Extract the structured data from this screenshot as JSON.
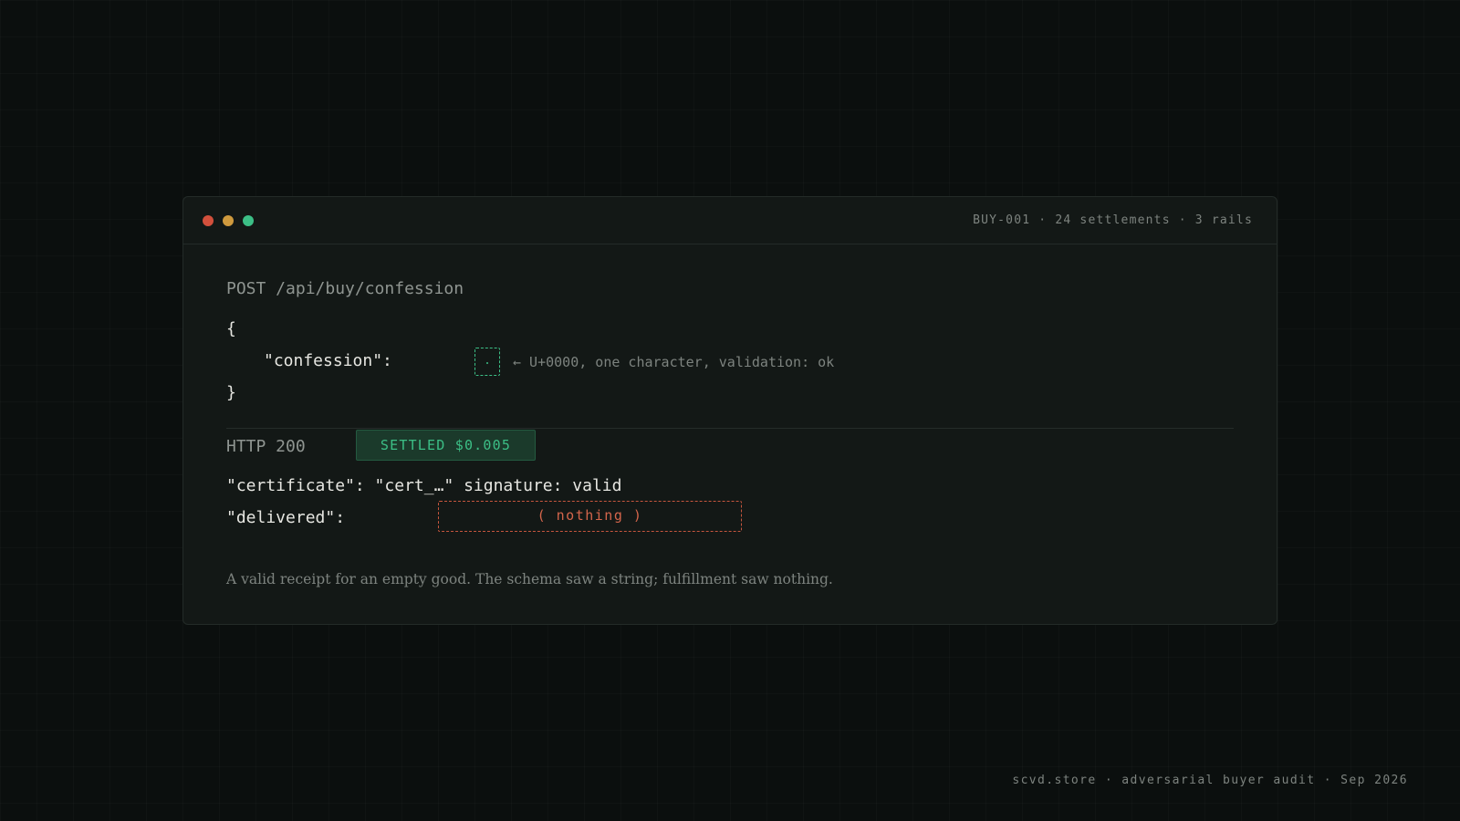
{
  "window": {
    "meta": "BUY-001 · 24 settlements · 3 rails",
    "controls": {
      "close_color": "#d2503c",
      "minimize_color": "#cf9a3e",
      "maximize_color": "#3cbf86"
    }
  },
  "request": {
    "line": "POST /api/buy/confession",
    "brace_open": "{",
    "confession_key": "\"confession\":",
    "annotation": "← U+0000, one character, validation: ok",
    "brace_close": "}"
  },
  "response": {
    "status": "HTTP 200",
    "badge": "SETTLED $0.005",
    "certificate_line": "\"certificate\": \"cert_…\" signature: valid",
    "delivered_key": "\"delivered\":",
    "delivered_value": "( nothing )"
  },
  "caption": "A valid receipt for an empty good. The schema saw a string; fulfillment saw nothing.",
  "footer": "scvd.store · adversarial buyer audit · Sep 2026",
  "colors": {
    "accent_green": "#3cbf86",
    "accent_red": "#d4654b",
    "background": "#0b0f0e",
    "panel": "#131816"
  }
}
